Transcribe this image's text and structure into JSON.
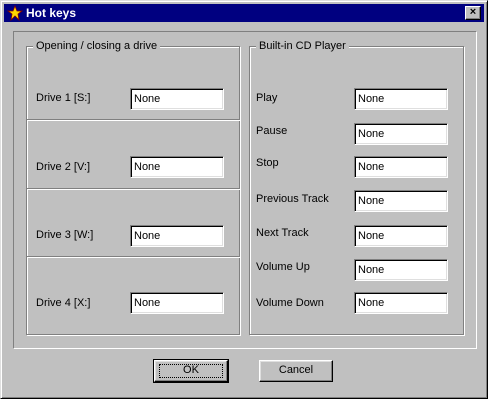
{
  "window": {
    "title": "Hot keys",
    "close_label": "×"
  },
  "drive_group": {
    "caption": "Opening / closing a drive",
    "rows": [
      {
        "label": "Drive 1 [S:]",
        "value": "None"
      },
      {
        "label": "Drive 2 [V:]",
        "value": "None"
      },
      {
        "label": "Drive 3 [W:]",
        "value": "None"
      },
      {
        "label": "Drive 4 [X:]",
        "value": "None"
      }
    ]
  },
  "cd_group": {
    "caption": "Built-in CD Player",
    "rows": [
      {
        "label": "Play",
        "value": "None"
      },
      {
        "label": "Pause",
        "value": "None"
      },
      {
        "label": "Stop",
        "value": "None"
      },
      {
        "label": "Previous Track",
        "value": "None"
      },
      {
        "label": "Next Track",
        "value": "None"
      },
      {
        "label": "Volume Up",
        "value": "None"
      },
      {
        "label": "Volume Down",
        "value": "None"
      }
    ]
  },
  "buttons": {
    "ok": "OK",
    "cancel": "Cancel"
  }
}
